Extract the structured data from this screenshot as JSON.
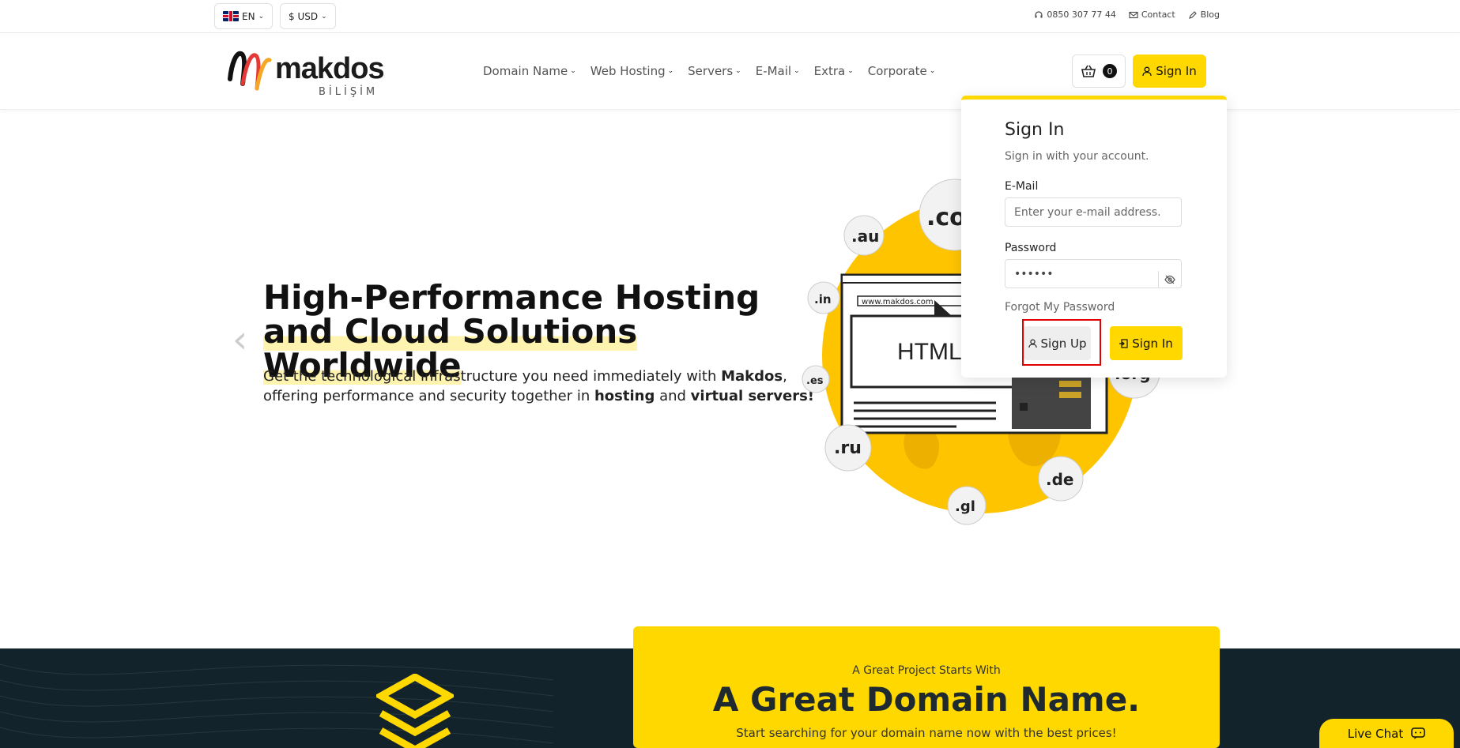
{
  "topbar": {
    "language": "EN",
    "currency": "$ USD",
    "phone": "0850 307 77 44",
    "contact": "Contact",
    "blog": "Blog"
  },
  "brand": {
    "name": "makdos",
    "sub": "BİLİŞİM"
  },
  "nav": {
    "items": [
      {
        "label": "Domain Name"
      },
      {
        "label": "Web Hosting"
      },
      {
        "label": "Servers"
      },
      {
        "label": "E-Mail"
      },
      {
        "label": "Extra"
      },
      {
        "label": "Corporate"
      }
    ],
    "cart_count": "0",
    "sign_in": "Sign In"
  },
  "hero": {
    "title_line1": "High-Performance Hosting",
    "title_line2": "and Cloud Solutions Worldwide",
    "desc_1": "Get the technological infrastructure you need immediately with ",
    "desc_b1": "Makdos",
    "desc_2": ",",
    "desc_3": "offering performance and security together in ",
    "desc_b2": "hosting",
    "desc_4": " and ",
    "desc_b3": "virtual servers!",
    "illustration": {
      "url": "www.makdos.com",
      "label": "HTML",
      "tlds": [
        ".com",
        ".au",
        ".in",
        ".es",
        ".ru",
        ".gl",
        ".de",
        ".org"
      ]
    }
  },
  "signin_popup": {
    "title": "Sign In",
    "subtitle": "Sign in with your account.",
    "email_label": "E-Mail",
    "email_placeholder": "Enter your e-mail address.",
    "password_label": "Password",
    "password_value": "••••••",
    "forgot": "Forgot My Password",
    "signup_button": "Sign Up",
    "signin_button": "Sign In"
  },
  "domain_section": {
    "pre": "A Great Project Starts With",
    "headline": "A Great Domain Name.",
    "sub": "Start searching for your domain name now with the best prices!"
  },
  "livechat": {
    "label": "Live Chat"
  },
  "colors": {
    "accent": "#ffd800",
    "dark": "#13232b"
  }
}
